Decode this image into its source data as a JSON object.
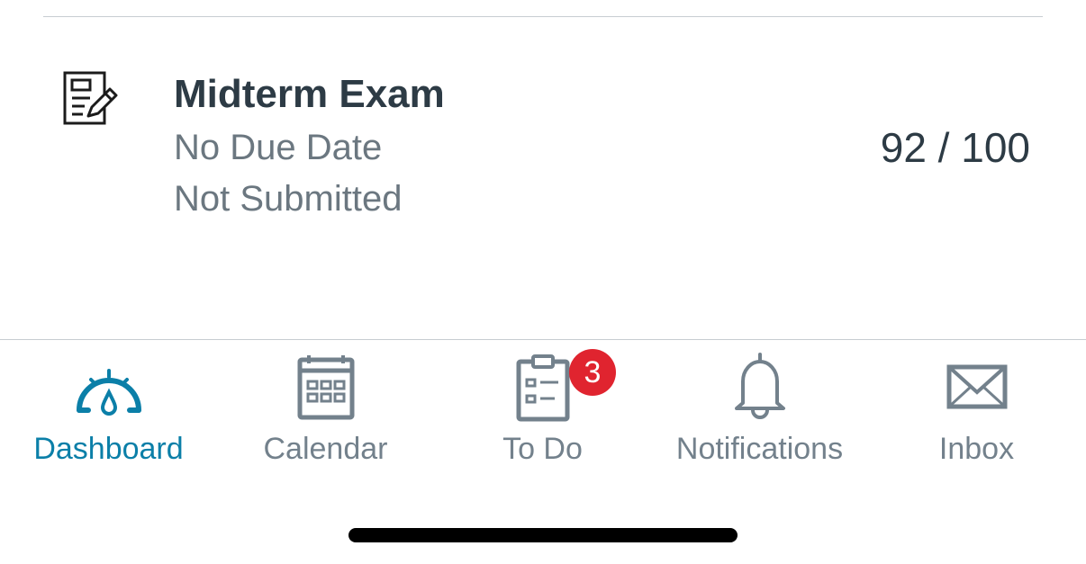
{
  "assignment": {
    "icon": "quiz-icon",
    "title": "Midterm Exam",
    "due": "No Due Date",
    "status": "Not Submitted",
    "score": "92 / 100"
  },
  "tabbar": {
    "active_color": "#0b7fa8",
    "inactive_color": "#73818c",
    "items": [
      {
        "label": "Dashboard",
        "icon": "dashboard-icon",
        "active": true
      },
      {
        "label": "Calendar",
        "icon": "calendar-icon",
        "active": false
      },
      {
        "label": "To Do",
        "icon": "todo-icon",
        "active": false,
        "badge": "3"
      },
      {
        "label": "Notifications",
        "icon": "bell-icon",
        "active": false
      },
      {
        "label": "Inbox",
        "icon": "mail-icon",
        "active": false
      }
    ]
  },
  "badge_color": "#e0242f"
}
